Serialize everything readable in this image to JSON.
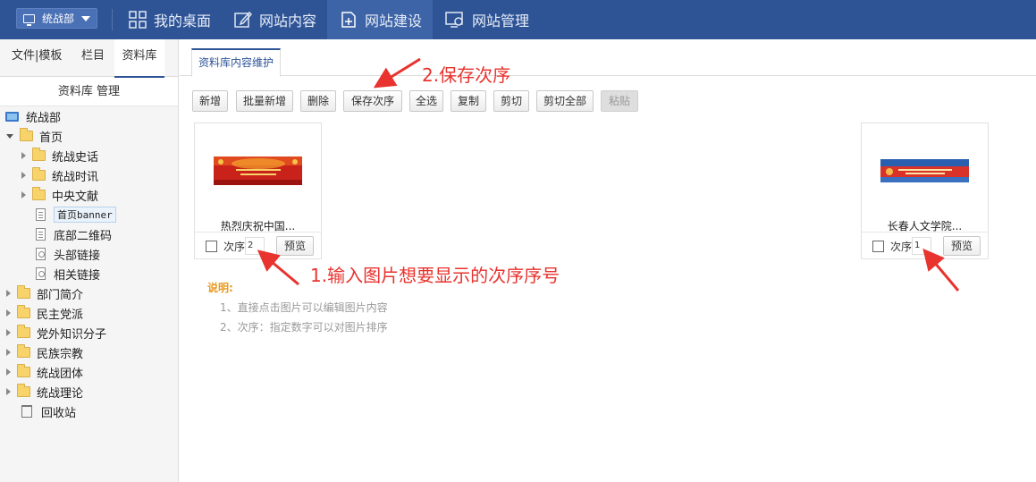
{
  "topbar": {
    "org_select": "统战部",
    "nav": [
      {
        "label": "我的桌面",
        "icon": "dashboard-icon"
      },
      {
        "label": "网站内容",
        "icon": "edit-icon"
      },
      {
        "label": "网站建设",
        "icon": "build-icon",
        "active": true
      },
      {
        "label": "网站管理",
        "icon": "manage-icon"
      }
    ],
    "colors": {
      "bar": "#2e5496",
      "active": "#3d64a7"
    }
  },
  "sidebar": {
    "tabs": [
      "文件|模板",
      "栏目",
      "资料库"
    ],
    "active_tab": "资料库",
    "header": "资料库 管理",
    "tree": {
      "root": "统战部",
      "home": "首页",
      "home_children": [
        "统战史话",
        "统战时讯",
        "中央文献",
        "首页banner",
        "底部二维码",
        "头部链接",
        "相关链接"
      ],
      "others": [
        "部门简介",
        "民主党派",
        "党外知识分子",
        "民族宗教",
        "统战团体",
        "统战理论"
      ],
      "recycle": "回收站"
    }
  },
  "main": {
    "tab": "资料库内容维护",
    "toolbar": [
      "新增",
      "批量新增",
      "删除",
      "保存次序",
      "全选",
      "复制",
      "剪切",
      "剪切全部",
      "粘贴"
    ],
    "cards": [
      {
        "title": "热烈庆祝中国...",
        "order_label": "次序",
        "order": "2",
        "preview": "预览"
      },
      {
        "title": "长春人文学院...",
        "order_label": "次序",
        "order": "1",
        "preview": "预览"
      }
    ],
    "notes": {
      "title": "说明:",
      "lines": [
        "1、直接点击图片可以编辑图片内容",
        "2、次序：指定数字可以对图片排序"
      ]
    }
  },
  "annotations": {
    "save_order": "2.保存次序",
    "input_order": "1.输入图片想要显示的次序序号",
    "color": "#e8332e"
  }
}
